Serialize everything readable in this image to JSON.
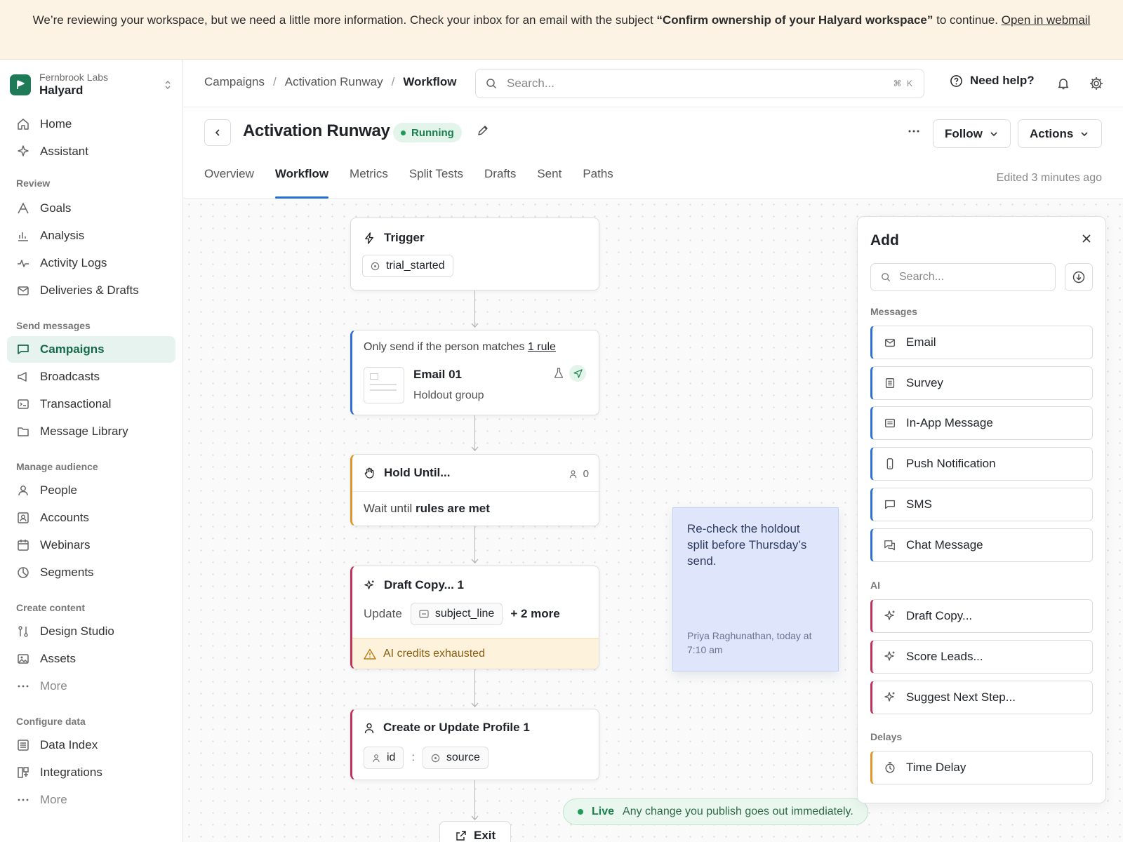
{
  "banner": {
    "text_before": "We’re reviewing your workspace, but we need a little more information. Check your inbox for an email with the subject ",
    "subject": "“Confirm ownership of your Halyard workspace”",
    "text_after": " to continue. ",
    "link": "Open in webmail"
  },
  "workspace": {
    "org": "Fernbrook Labs",
    "name": "Halyard"
  },
  "sidebar": {
    "top_items": [
      {
        "label": "Home",
        "icon": "home-icon"
      },
      {
        "label": "Assistant",
        "icon": "sparkle-icon"
      }
    ],
    "sections": [
      {
        "title": "Review",
        "items": [
          "Goals",
          "Analysis",
          "Activity Logs",
          "Deliveries & Drafts"
        ]
      },
      {
        "title": "Send messages",
        "items": [
          "Campaigns",
          "Broadcasts",
          "Transactional",
          "Message Library"
        ]
      },
      {
        "title": "Manage audience",
        "items": [
          "People",
          "Accounts",
          "Webinars",
          "Segments"
        ]
      },
      {
        "title": "Create content",
        "items": [
          "Design Studio",
          "Assets",
          "More"
        ]
      },
      {
        "title": "Configure data",
        "items": [
          "Data Index",
          "Integrations",
          "More"
        ]
      }
    ],
    "active": "Campaigns"
  },
  "topbar": {
    "breadcrumbs": [
      "Campaigns",
      "Activation Runway",
      "Workflow"
    ],
    "search_placeholder": "Search...",
    "search_shortcut": "⌘ K",
    "help_label": "Need help?"
  },
  "header": {
    "title": "Activation Runway",
    "status": "Running",
    "follow_label": "Follow",
    "actions_label": "Actions",
    "tabs": [
      "Overview",
      "Workflow",
      "Metrics",
      "Split Tests",
      "Drafts",
      "Sent",
      "Paths"
    ],
    "active_tab": "Workflow",
    "edited": "Edited 3 minutes ago"
  },
  "workflow": {
    "trigger": {
      "title": "Trigger",
      "event": "trial_started"
    },
    "email": {
      "condition_prefix": "Only send if the person matches ",
      "condition_link": "1 rule",
      "name": "Email 01",
      "subtitle": "Holdout group"
    },
    "hold": {
      "title": "Hold Until...",
      "count": "0",
      "desc_prefix": "Wait until ",
      "desc_bold": "rules are met"
    },
    "draft": {
      "title": "Draft Copy... 1",
      "update_label": "Update",
      "field": "subject_line",
      "more": "+ 2 more",
      "warning": "AI credits exhausted"
    },
    "profile": {
      "title": "Create or Update Profile 1",
      "key": "id",
      "sep": ":",
      "value": "source"
    },
    "exit_label": "Exit"
  },
  "note": {
    "text": "Re-check the holdout split before Thursday’s send.",
    "author": "Priya Raghunathan, today at 7:10 am"
  },
  "live": {
    "label": "Live",
    "text": "Any change you publish goes out immediately."
  },
  "add_panel": {
    "title": "Add",
    "search_placeholder": "Search...",
    "sections": [
      {
        "title": "Messages",
        "items": [
          "Email",
          "Survey",
          "In-App Message",
          "Push Notification",
          "SMS",
          "Chat Message"
        ]
      },
      {
        "title": "AI",
        "items": [
          "Draft Copy...",
          "Score Leads...",
          "Suggest Next Step..."
        ]
      },
      {
        "title": "Delays",
        "items": [
          "Time Delay"
        ]
      }
    ]
  },
  "colors": {
    "brand": "#1f7a58",
    "tab_accent": "#1f6fd1",
    "email_accent": "#2d6fd6",
    "hold_accent": "#e0952b",
    "ai_accent": "#c0325a",
    "note_bg": "#dfe6fb",
    "banner_bg": "#fdf3e4"
  }
}
